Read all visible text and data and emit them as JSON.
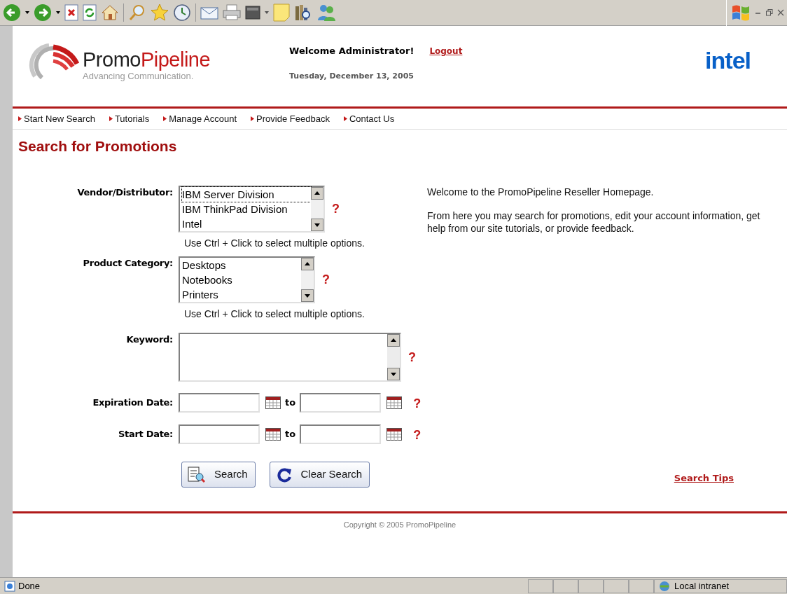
{
  "status_bar": {
    "message": "Done",
    "zone": "Local intranet"
  },
  "header": {
    "logo_parts": [
      "Promo",
      "Pipeline"
    ],
    "tagline": "Advancing Communication.",
    "welcome": "Welcome Administrator!",
    "logout": "Logout",
    "date": "Tuesday, December 13, 2005",
    "partner_logo": "intel"
  },
  "nav": [
    "Start New Search",
    "Tutorials",
    "Manage Account",
    "Provide Feedback",
    "Contact Us"
  ],
  "title": "Search for Promotions",
  "form": {
    "vendor": {
      "label": "Vendor/Distributor:",
      "options": [
        {
          "text": "IBM Server Division",
          "focused": true
        },
        {
          "text": "IBM ThinkPad Division",
          "focused": false
        },
        {
          "text": "Intel",
          "focused": false
        }
      ],
      "help": "?",
      "hint": "Use Ctrl + Click to select multiple options."
    },
    "category": {
      "label": "Product Category:",
      "options": [
        {
          "text": "Desktops",
          "focused": false
        },
        {
          "text": "Notebooks",
          "focused": false
        },
        {
          "text": "Printers",
          "focused": false
        }
      ],
      "help": "?",
      "hint": "Use Ctrl + Click to select multiple options."
    },
    "keyword": {
      "label": "Keyword:",
      "help": "?"
    },
    "dates": [
      {
        "label": "Expiration Date:",
        "to": "to",
        "help": "?"
      },
      {
        "label": "Start Date:",
        "to": "to",
        "help": "?"
      }
    ],
    "buttons": [
      {
        "kind": "search",
        "label": "Search"
      },
      {
        "kind": "clear",
        "label": "Clear Search"
      }
    ]
  },
  "intro": [
    "Welcome to the PromoPipeline Reseller Homepage.",
    "From here you may search for promotions, edit your account information, get help from our site tutorials, or provide feedback."
  ],
  "search_tips": "Search Tips",
  "footer": "Copyright © 2005 PromoPipeline"
}
